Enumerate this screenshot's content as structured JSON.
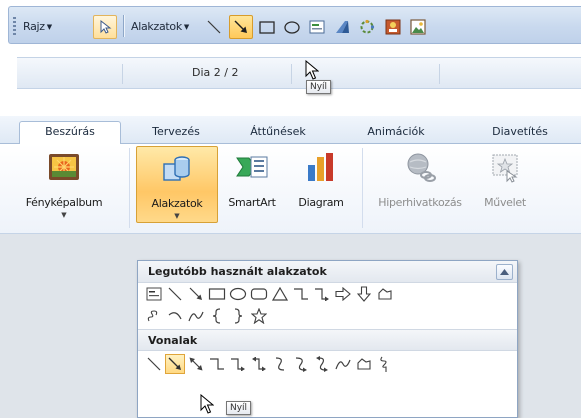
{
  "drawing_toolbar": {
    "draw_menu_label": "Rajz",
    "shapes_menu_label": "Alakzatok",
    "tools": [
      {
        "name": "line-icon"
      },
      {
        "name": "arrow-icon",
        "active": true
      },
      {
        "name": "rectangle-icon"
      },
      {
        "name": "oval-icon"
      },
      {
        "name": "textbox-icon"
      },
      {
        "name": "wordart-icon"
      },
      {
        "name": "diagram-icon"
      },
      {
        "name": "clipart-icon"
      },
      {
        "name": "picture-icon"
      }
    ],
    "tooltip": "Nyíl"
  },
  "status_bar": {
    "slide_info": "Dia 2 / 2"
  },
  "ribbon": {
    "tabs": [
      {
        "label": "Beszúrás",
        "selected": true
      },
      {
        "label": "Tervezés"
      },
      {
        "label": "Áttűnések"
      },
      {
        "label": "Animációk"
      },
      {
        "label": "Diavetítés"
      }
    ],
    "commands": [
      {
        "label": "Fényképalbum",
        "icon": "photo-album-icon",
        "has_dropdown": true
      },
      {
        "label": "Alakzatok",
        "icon": "shapes-icon",
        "has_dropdown": true,
        "pressed": true
      },
      {
        "label": "SmartArt",
        "icon": "smartart-icon"
      },
      {
        "label": "Diagram",
        "icon": "chart-icon"
      },
      {
        "label": "Hiperhivatkozás",
        "icon": "hyperlink-icon",
        "disabled": true
      },
      {
        "label": "Művelet",
        "icon": "action-icon",
        "disabled": true
      }
    ]
  },
  "shapes_gallery": {
    "recent_title": "Legutóbb használt alakzatok",
    "lines_title": "Vonalak",
    "tooltip": "Nyíl"
  },
  "colors": {
    "accent_active": "#ffc95a",
    "ribbon_tab_border": "#a8bdd8",
    "toolbar_bg": "#c9d9ee"
  }
}
